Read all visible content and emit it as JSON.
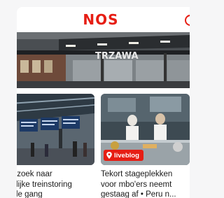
{
  "header": {
    "logo_text": "NOS",
    "brand_color": "#e61e14",
    "action_icon": "circle-icon"
  },
  "hero": {
    "image": "station-platform-photo",
    "sign_text": "TRZAWA"
  },
  "cards": [
    {
      "image": "train-station-departure-boards-photo",
      "title": "erzoek naar\nlelijke treinstoring\nolle gang"
    },
    {
      "image": "chefs-in-kitchen-photo",
      "badge": "liveblog",
      "badge_icon": "location-pin-icon",
      "title": "Tekort stageplekken\nvoor mbo'ers neemt\ngestaag af • Peru n..."
    }
  ]
}
